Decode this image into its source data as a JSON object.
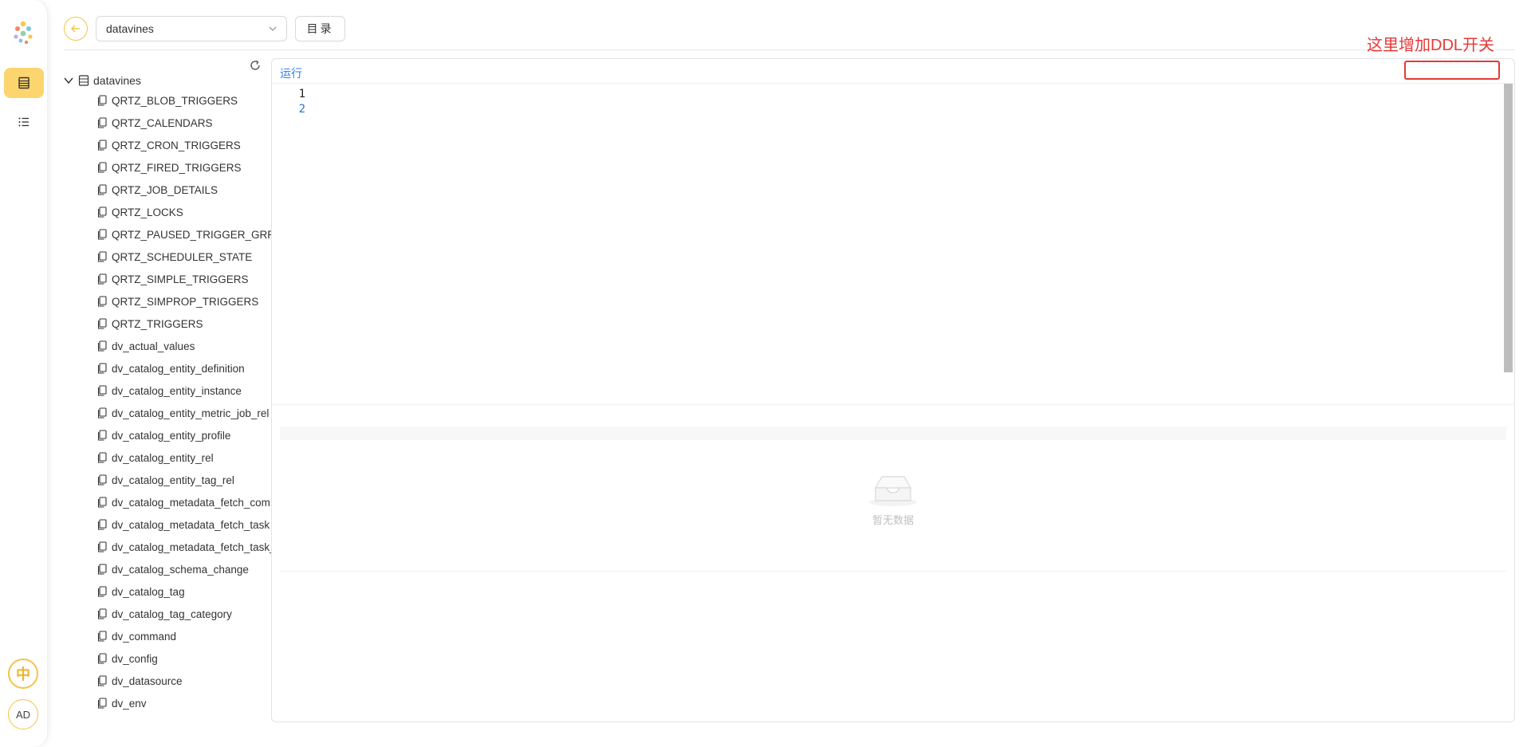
{
  "header": {
    "database_value": "datavines",
    "catalog_button": "目录"
  },
  "tree": {
    "root_label": "datavines",
    "items": [
      "QRTZ_BLOB_TRIGGERS",
      "QRTZ_CALENDARS",
      "QRTZ_CRON_TRIGGERS",
      "QRTZ_FIRED_TRIGGERS",
      "QRTZ_JOB_DETAILS",
      "QRTZ_LOCKS",
      "QRTZ_PAUSED_TRIGGER_GRPS",
      "QRTZ_SCHEDULER_STATE",
      "QRTZ_SIMPLE_TRIGGERS",
      "QRTZ_SIMPROP_TRIGGERS",
      "QRTZ_TRIGGERS",
      "dv_actual_values",
      "dv_catalog_entity_definition",
      "dv_catalog_entity_instance",
      "dv_catalog_entity_metric_job_rel",
      "dv_catalog_entity_profile",
      "dv_catalog_entity_rel",
      "dv_catalog_entity_tag_rel",
      "dv_catalog_metadata_fetch_com",
      "dv_catalog_metadata_fetch_task",
      "dv_catalog_metadata_fetch_task_",
      "dv_catalog_schema_change",
      "dv_catalog_tag",
      "dv_catalog_tag_category",
      "dv_command",
      "dv_config",
      "dv_datasource",
      "dv_env"
    ]
  },
  "editor": {
    "run_label": "运行",
    "line_numbers": [
      "1",
      "2"
    ]
  },
  "results": {
    "empty_text": "暂无数据"
  },
  "rail": {
    "lang_label": "中",
    "user_initials": "AD"
  },
  "annotation": {
    "text": "这里增加DDL开关"
  },
  "colors": {
    "accent": "#fcd56f",
    "link": "#2d7ff9",
    "annotation": "#e53935"
  }
}
